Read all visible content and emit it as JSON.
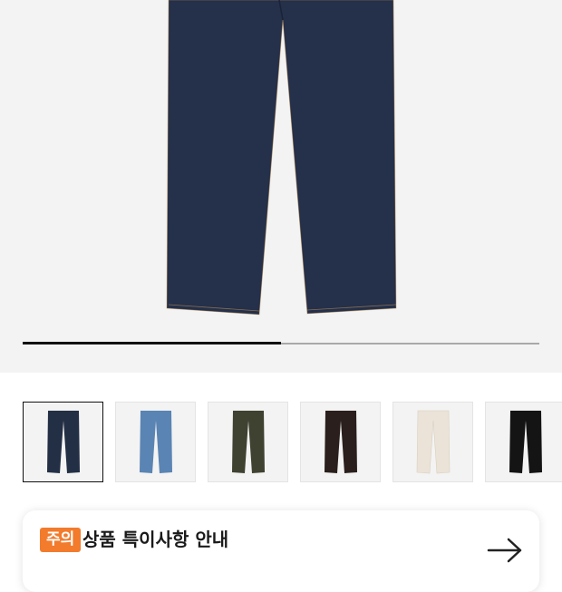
{
  "gallery": {
    "progress": 0.5,
    "selected_index": 0
  },
  "thumbnails": [
    {
      "name": "thumb-dark-indigo",
      "color": "#232f45"
    },
    {
      "name": "thumb-light-blue",
      "color": "#5a84b3"
    },
    {
      "name": "thumb-olive",
      "color": "#3f4230"
    },
    {
      "name": "thumb-dark-brown",
      "color": "#2a1f1c"
    },
    {
      "name": "thumb-ecru",
      "color": "#ebe3d7"
    },
    {
      "name": "thumb-black",
      "color": "#141414"
    }
  ],
  "notice": {
    "badge": "주의",
    "title": "상품 특이사항 안내",
    "subtitle": "",
    "arrow_icon": "arrow-right-icon"
  }
}
